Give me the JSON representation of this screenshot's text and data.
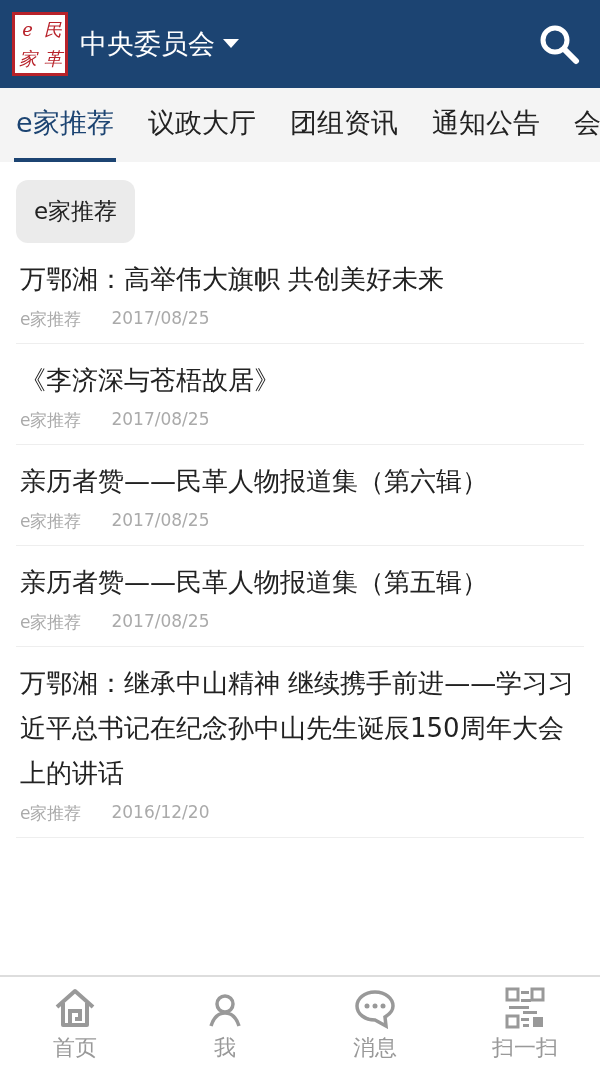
{
  "header": {
    "logo_chars": [
      "e",
      "民",
      "家",
      "革"
    ],
    "title": "中央委员会"
  },
  "tabs": [
    {
      "label": "e家推荐",
      "selected": true
    },
    {
      "label": "议政大厅",
      "selected": false
    },
    {
      "label": "团组资讯",
      "selected": false
    },
    {
      "label": "通知公告",
      "selected": false
    },
    {
      "label": "会",
      "selected": false
    }
  ],
  "section_chip": "e家推荐",
  "articles": [
    {
      "title": "万鄂湘：高举伟大旗帜 共创美好未来",
      "source": "e家推荐",
      "date": "2017/08/25"
    },
    {
      "title": "《李济深与苍梧故居》",
      "source": "e家推荐",
      "date": "2017/08/25"
    },
    {
      "title": "亲历者赞——民革人物报道集（第六辑）",
      "source": "e家推荐",
      "date": "2017/08/25"
    },
    {
      "title": "亲历者赞——民革人物报道集（第五辑）",
      "source": "e家推荐",
      "date": "2017/08/25"
    },
    {
      "title": "万鄂湘：继承中山精神 继续携手前进——学习习近平总书记在纪念孙中山先生诞辰150周年大会上的讲话",
      "source": "e家推荐",
      "date": "2016/12/20"
    }
  ],
  "bottom_nav": [
    {
      "kind": "home",
      "label": "首页"
    },
    {
      "kind": "me",
      "label": "我"
    },
    {
      "kind": "messages",
      "label": "消息"
    },
    {
      "kind": "scan",
      "label": "扫一扫"
    }
  ]
}
